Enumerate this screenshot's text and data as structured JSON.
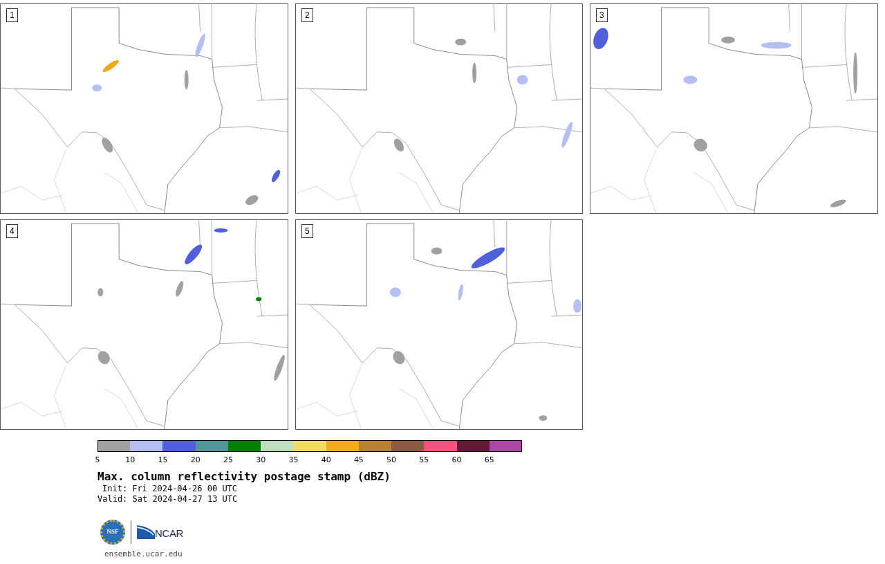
{
  "panels": [
    {
      "label": "1"
    },
    {
      "label": "2"
    },
    {
      "label": "3"
    },
    {
      "label": "4"
    },
    {
      "label": "5"
    }
  ],
  "colorbar": {
    "bins": [
      {
        "label": "5",
        "color": "#a0a0a0"
      },
      {
        "label": "10",
        "color": "#b4bef0"
      },
      {
        "label": "15",
        "color": "#5060d8"
      },
      {
        "label": "20",
        "color": "#509698"
      },
      {
        "label": "25",
        "color": "#008000"
      },
      {
        "label": "30",
        "color": "#bedebe"
      },
      {
        "label": "35",
        "color": "#f0dc60"
      },
      {
        "label": "40",
        "color": "#f0ac18"
      },
      {
        "label": "45",
        "color": "#b88030"
      },
      {
        "label": "50",
        "color": "#8c5a40"
      },
      {
        "label": "55",
        "color": "#f45080"
      },
      {
        "label": "60",
        "color": "#641838"
      },
      {
        "label": "65",
        "color": "#ac48a4"
      }
    ]
  },
  "title": "Max. column reflectivity postage stamp (dBZ)",
  "init": "Init: Fri 2024-04-26 00 UTC",
  "valid": "Valid: Sat 2024-04-27 13 UTC",
  "logos": {
    "nsf": "NSF",
    "ncar": "NCAR"
  },
  "footer": "ensemble.ucar.edu"
}
